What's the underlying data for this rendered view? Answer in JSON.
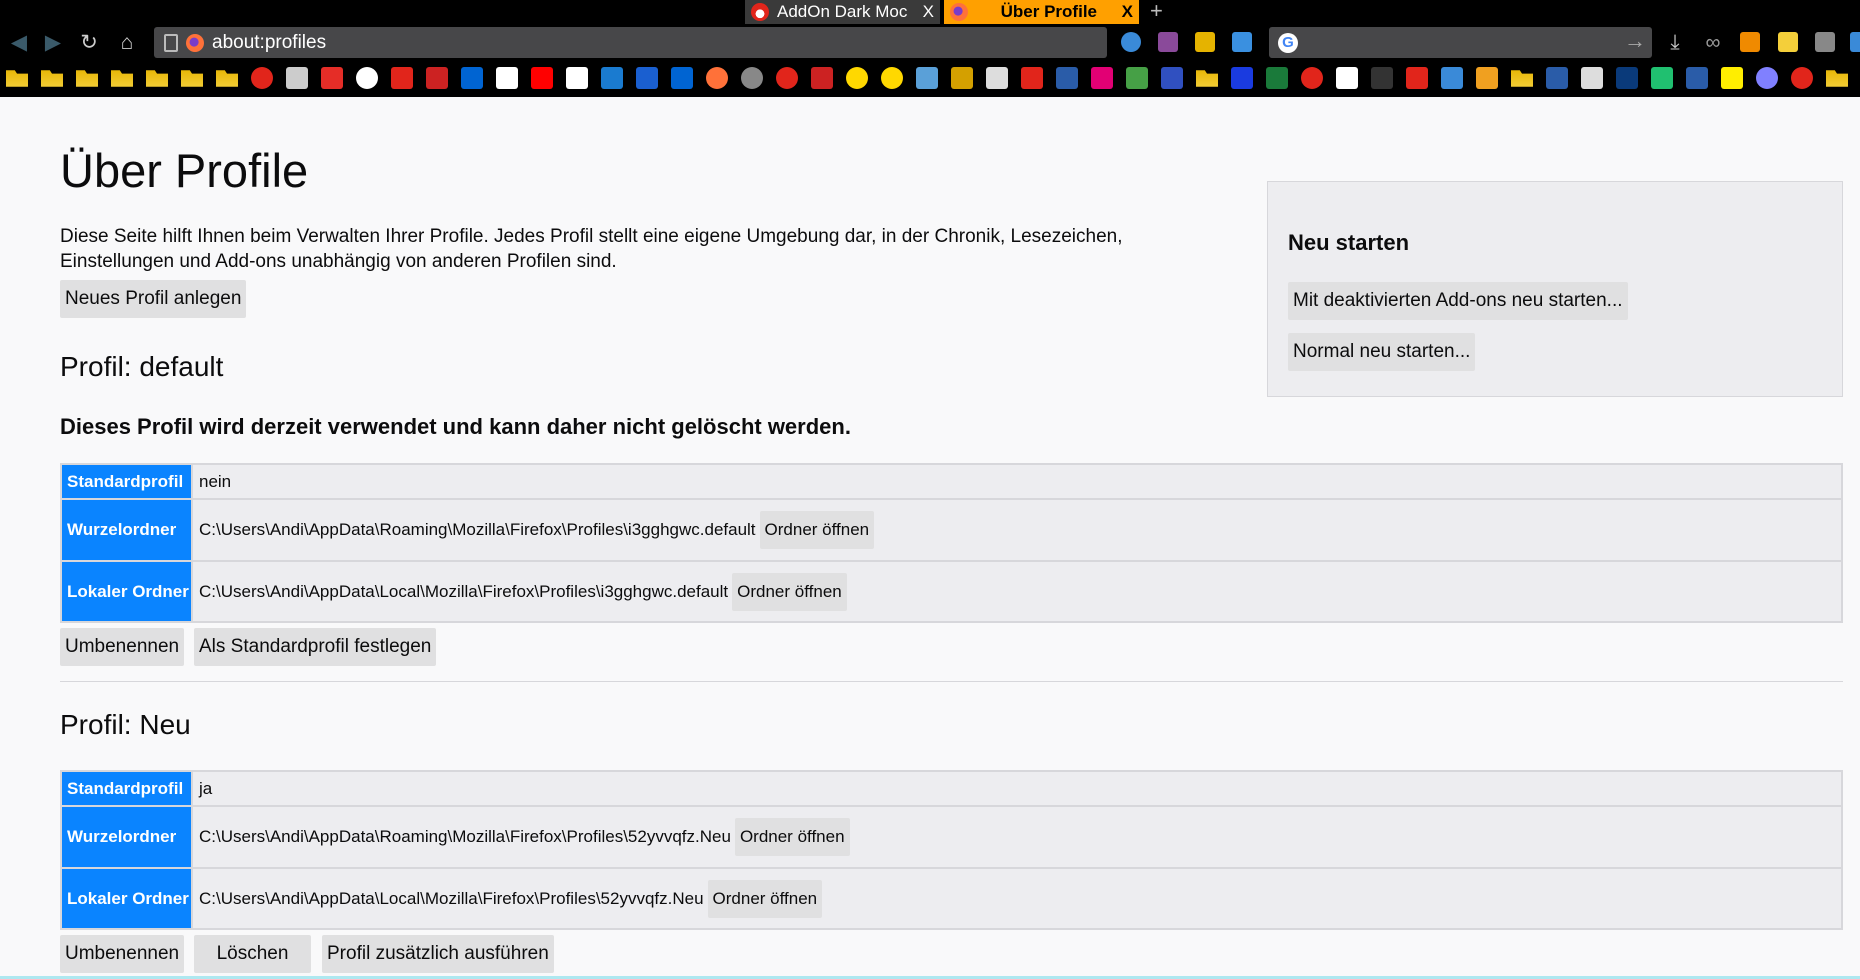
{
  "tabs": [
    {
      "title": "AddOn Dark Moc",
      "close": "X",
      "icon": "addon-flame-icon"
    },
    {
      "title": "Über Profile",
      "close": "X",
      "icon": "firefox-icon",
      "active": true
    }
  ],
  "new_tab": "+",
  "toolbar": {
    "url": "about:profiles",
    "search_placeholder": "",
    "search_engine": "G",
    "go": "→"
  },
  "bookmarks": [
    {
      "icon": "folder",
      "c": "#e5b300"
    },
    {
      "icon": "folder",
      "c": "#e5b300"
    },
    {
      "icon": "folder",
      "c": "#e5b300"
    },
    {
      "icon": "folder",
      "c": "#e5b300"
    },
    {
      "icon": "folder",
      "c": "#e5b300"
    },
    {
      "icon": "folder",
      "c": "#e5b300"
    },
    {
      "icon": "folder",
      "c": "#e5b300"
    },
    {
      "icon": "flame",
      "c": "#e1251b"
    },
    {
      "icon": "bz",
      "c": "#cccccc"
    },
    {
      "icon": "youtube",
      "c": "#e52d27"
    },
    {
      "icon": "at",
      "c": "#ffffff"
    },
    {
      "icon": "x",
      "c": "#e1251b"
    },
    {
      "icon": "news",
      "c": "#cc2222"
    },
    {
      "icon": "ebay",
      "c": "#0064d2"
    },
    {
      "icon": "amazon",
      "c": "#ffffff"
    },
    {
      "icon": "sparkasse",
      "c": "#ff0000"
    },
    {
      "icon": "gh",
      "c": "#ffffff"
    },
    {
      "icon": "monitor",
      "c": "#1a7bd0"
    },
    {
      "icon": "feather",
      "c": "#1a5fd0"
    },
    {
      "icon": "ebay",
      "c": "#0064d2"
    },
    {
      "icon": "firefox",
      "c": "#ff7139"
    },
    {
      "icon": "disc",
      "c": "#888888"
    },
    {
      "icon": "flame",
      "c": "#e1251b"
    },
    {
      "icon": "reload",
      "c": "#cc2222"
    },
    {
      "icon": "smiley-glasses",
      "c": "#ffd800"
    },
    {
      "icon": "smiley",
      "c": "#ffd800"
    },
    {
      "icon": "beach",
      "c": "#5aa0d8"
    },
    {
      "icon": "diamond",
      "c": "#d4a000"
    },
    {
      "icon": "clipboard",
      "c": "#dddddd"
    },
    {
      "icon": "c-red",
      "c": "#e1251b"
    },
    {
      "icon": "cb",
      "c": "#2a5ca8"
    },
    {
      "icon": "telekom",
      "c": "#e20074"
    },
    {
      "icon": "diamond-green",
      "c": "#46a046"
    },
    {
      "icon": "people",
      "c": "#3050c0"
    },
    {
      "icon": "folder",
      "c": "#e5b300"
    },
    {
      "icon": "info",
      "c": "#1a3be0"
    },
    {
      "icon": "w3",
      "c": "#1a7a3a"
    },
    {
      "icon": "sh",
      "c": "#e1251b"
    },
    {
      "icon": "wp",
      "c": "#ffffff"
    },
    {
      "icon": "pen",
      "c": "#333333"
    },
    {
      "icon": "gmail",
      "c": "#e1251b"
    },
    {
      "icon": "chat",
      "c": "#3a8ad8"
    },
    {
      "icon": "dots",
      "c": "#f0a020"
    },
    {
      "icon": "folder",
      "c": "#e5b300"
    },
    {
      "icon": "cb",
      "c": "#2a5ca8"
    },
    {
      "icon": "bracket",
      "c": "#dddddd"
    },
    {
      "icon": "ndr",
      "c": "#0a3a7a"
    },
    {
      "icon": "d-green",
      "c": "#20c070"
    },
    {
      "icon": "cb",
      "c": "#2a5ca8"
    },
    {
      "icon": "b64",
      "c": "#ffee00"
    },
    {
      "icon": "pin",
      "c": "#8080ff"
    },
    {
      "icon": "flame",
      "c": "#e1251b"
    },
    {
      "icon": "folder",
      "c": "#e5b300"
    }
  ],
  "page": {
    "title": "Über Profile",
    "description": "Diese Seite hilft Ihnen beim Verwalten Ihrer Profile. Jedes Profil stellt eine eigene Umgebung dar, in der Chronik, Lesezeichen, Einstellungen und Add-ons unabhängig von anderen Profilen sind.",
    "new_profile": "Neues Profil anlegen",
    "restart": {
      "title": "Neu starten",
      "disable_addons": "Mit deaktivierten Add-ons neu starten...",
      "normal": "Normal neu starten..."
    },
    "labels": {
      "default": "Standardprofil",
      "root": "Wurzelordner",
      "local": "Lokaler Ordner",
      "open": "Ordner öffnen",
      "rename": "Umbenennen",
      "set_default": "Als Standardprofil festlegen",
      "remove": "Löschen",
      "launch": "Profil zusätzlich ausführen"
    },
    "profiles": [
      {
        "heading": "Profil: default",
        "notice": "Dieses Profil wird derzeit verwendet und kann daher nicht gelöscht werden.",
        "is_default": "nein",
        "root": "C:\\Users\\Andi\\AppData\\Roaming\\Mozilla\\Firefox\\Profiles\\i3gghgwc.default",
        "local": "C:\\Users\\Andi\\AppData\\Local\\Mozilla\\Firefox\\Profiles\\i3gghgwc.default"
      },
      {
        "heading": "Profil: Neu",
        "is_default": "ja",
        "root": "C:\\Users\\Andi\\AppData\\Roaming\\Mozilla\\Firefox\\Profiles\\52yvvqfz.Neu",
        "local": "C:\\Users\\Andi\\AppData\\Local\\Mozilla\\Firefox\\Profiles\\52yvvqfz.Neu"
      }
    ]
  }
}
